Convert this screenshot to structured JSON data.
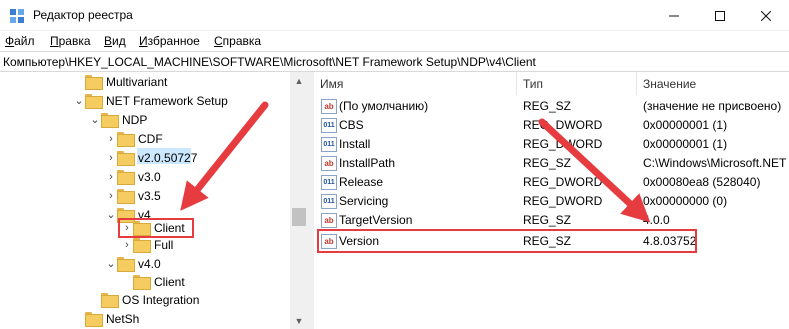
{
  "window": {
    "title": "Редактор реестра",
    "buttons": {
      "minimize": "—",
      "maximize": "☐",
      "close": "✕"
    }
  },
  "menu": {
    "items": [
      {
        "key": "Ф",
        "rest": "айл"
      },
      {
        "key": "П",
        "rest": "равка"
      },
      {
        "key": "В",
        "rest": "ид"
      },
      {
        "key": "И",
        "rest": "збранное"
      },
      {
        "key": "С",
        "rest": "правка"
      }
    ]
  },
  "address": {
    "path": "Компьютер\\HKEY_LOCAL_MACHINE\\SOFTWARE\\Microsoft\\NET Framework Setup\\NDP\\v4\\Client"
  },
  "tree": {
    "nodes": [
      {
        "label": "Multivariant",
        "chevron": ""
      },
      {
        "label": "NET Framework Setup",
        "chevron": "⌄"
      },
      {
        "label": "NDP",
        "chevron": "⌄"
      },
      {
        "label": "CDF",
        "chevron": "›"
      },
      {
        "label": "v2.0.50727",
        "chevron": "›"
      },
      {
        "label": "v3.0",
        "chevron": "›"
      },
      {
        "label": "v3.5",
        "chevron": "›"
      },
      {
        "label": "v4",
        "chevron": "⌄"
      },
      {
        "label": "Client",
        "chevron": "›"
      },
      {
        "label": "Full",
        "chevron": "›"
      },
      {
        "label": "v4.0",
        "chevron": "⌄"
      },
      {
        "label": "Client",
        "chevron": ""
      },
      {
        "label": "OS Integration",
        "chevron": ""
      },
      {
        "label": "NetSh",
        "chevron": ""
      }
    ]
  },
  "scrollbar": {
    "up": "▲",
    "down": "▼"
  },
  "list": {
    "headers": {
      "name": "Имя",
      "type": "Тип",
      "value": "Значение"
    },
    "rows": [
      {
        "icon": "ab",
        "name": "(По умолчанию)",
        "type": "REG_SZ",
        "value": "(значение не присвоено)"
      },
      {
        "icon": "011",
        "name": "CBS",
        "type": "REG_DWORD",
        "value": "0x00000001 (1)"
      },
      {
        "icon": "011",
        "name": "Install",
        "type": "REG_DWORD",
        "value": "0x00000001 (1)"
      },
      {
        "icon": "ab",
        "name": "InstallPath",
        "type": "REG_SZ",
        "value": "C:\\Windows\\Microsoft.NET"
      },
      {
        "icon": "011",
        "name": "Release",
        "type": "REG_DWORD",
        "value": "0x00080ea8 (528040)"
      },
      {
        "icon": "011",
        "name": "Servicing",
        "type": "REG_DWORD",
        "value": "0x00000000 (0)"
      },
      {
        "icon": "ab",
        "name": "TargetVersion",
        "type": "REG_SZ",
        "value": "4.0.0"
      },
      {
        "icon": "ab",
        "name": "Version",
        "type": "REG_SZ",
        "value": "4.8.03752"
      }
    ]
  },
  "annotations": {
    "accent_color": "#e63b3f"
  }
}
